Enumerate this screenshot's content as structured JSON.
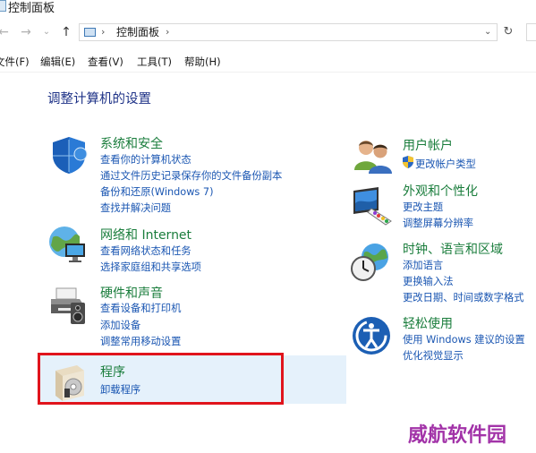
{
  "window": {
    "title": "控制面板"
  },
  "nav": {
    "back": "←",
    "forward": "→",
    "up": "↑",
    "refresh": "↻"
  },
  "address": {
    "chev1": "›",
    "path": "控制面板",
    "chev2": "›",
    "dropdown": "⌄"
  },
  "menu": [
    {
      "label": "文件(F)"
    },
    {
      "label": "编辑(E)"
    },
    {
      "label": "查看(V)"
    },
    {
      "label": "工具(T)"
    },
    {
      "label": "帮助(H)"
    }
  ],
  "main": {
    "heading": "调整计算机的设置"
  },
  "left_categories": [
    {
      "title": "系统和安全",
      "icon": "shield-icon",
      "links": [
        "查看你的计算机状态",
        "通过文件历史记录保存你的文件备份副本",
        "备份和还原(Windows 7)",
        "查找并解决问题"
      ]
    },
    {
      "title": "网络和 Internet",
      "icon": "network-globe-icon",
      "links": [
        "查看网络状态和任务",
        "选择家庭组和共享选项"
      ]
    },
    {
      "title": "硬件和声音",
      "icon": "printer-speaker-icon",
      "links": [
        "查看设备和打印机",
        "添加设备",
        "调整常用移动设置"
      ]
    },
    {
      "title": "程序",
      "icon": "programs-box-icon",
      "links": [
        "卸载程序"
      ]
    }
  ],
  "right_categories": [
    {
      "title": "用户帐户",
      "icon": "users-icon",
      "links": [
        "更改帐户类型"
      ]
    },
    {
      "title": "外观和个性化",
      "icon": "monitor-palette-icon",
      "links": [
        "更改主题",
        "调整屏幕分辨率"
      ]
    },
    {
      "title": "时钟、语言和区域",
      "icon": "clock-globe-icon",
      "links": [
        "添加语言",
        "更换输入法",
        "更改日期、时间或数字格式"
      ]
    },
    {
      "title": "轻松使用",
      "icon": "ease-of-access-icon",
      "links": [
        "使用 Windows 建议的设置",
        "优化视觉显示"
      ]
    }
  ],
  "watermark": "威航软件园",
  "colors": {
    "category_title": "#1a7d3c",
    "link": "#1a56b2",
    "heading": "#1e3287",
    "highlight": "#e5f1fb",
    "annotation_box": "#e0141c",
    "watermark": "#a233a8"
  }
}
